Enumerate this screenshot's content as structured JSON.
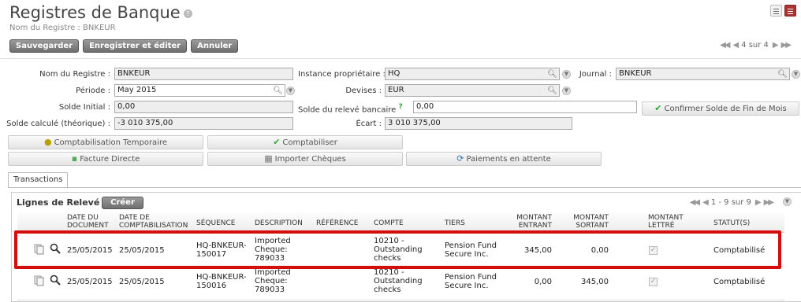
{
  "header": {
    "title": "Registres de Banque",
    "help": "?",
    "breadcrumb": "Nom du Registre : BNKEUR"
  },
  "toolbar": {
    "save_label": "Sauvegarder",
    "save_edit_label": "Enregistrer et éditer",
    "cancel_label": "Annuler",
    "pager": "4 sur 4"
  },
  "form": {
    "nom_registre_label": "Nom du Registre :",
    "nom_registre_value": "BNKEUR",
    "periode_label": "Période :",
    "periode_value": "May 2015",
    "solde_initial_label": "Solde Initial :",
    "solde_initial_value": "0,00",
    "solde_calcule_label": "Solde calculé (théorique) :",
    "solde_calcule_value": "-3 010 375,00",
    "instance_label": "Instance propriétaire :",
    "instance_value": "HQ",
    "devises_label": "Devises :",
    "devises_value": "EUR",
    "solde_releve_label": "Solde du relevé bancaire",
    "solde_releve_help": "?",
    "solde_releve_value": "0,00",
    "ecart_label": "Écart :",
    "ecart_value": "3 010 375,00",
    "journal_label": "Journal :",
    "journal_value": "BNKEUR",
    "confirm_label": "Confirmer Solde de Fin de Mois"
  },
  "actions": {
    "comptab_temp": "Comptabilisation Temporaire",
    "comptabiliser": "Comptabiliser",
    "facture_directe": "Facture Directe",
    "importer_cheques": "Importer Chèques",
    "paiements_attente": "Paiements en attente"
  },
  "tabs": {
    "transactions": "Transactions"
  },
  "lines": {
    "title": "Lignes de Relevé",
    "create_label": "Créer",
    "pager": "1 - 9 sur 9",
    "columns": {
      "date_doc": [
        "DATE DU",
        "DOCUMENT"
      ],
      "date_compta": [
        "DATE DE",
        "COMPTABILISATION"
      ],
      "sequence": "SÉQUENCE",
      "description": "DESCRIPTION",
      "reference": "RÉFÉRENCE",
      "compte": "COMPTE",
      "tiers": "TIERS",
      "montant_entrant": [
        "MONTANT",
        "ENTRANT"
      ],
      "montant_sortant": [
        "MONTANT",
        "SORTANT"
      ],
      "montant_lettre": [
        "MONTANT",
        "LETTRÉ"
      ],
      "statut": "STATUT(S)"
    },
    "rows": [
      {
        "date_doc": "25/05/2015",
        "date_compta": "25/05/2015",
        "sequence": [
          "HQ-BNKEUR-",
          "150017"
        ],
        "description": [
          "Imported",
          "Cheque:",
          "789033"
        ],
        "reference": "",
        "compte": [
          "10210 -",
          "Outstanding",
          "checks"
        ],
        "tiers": [
          "Pension Fund",
          "Secure Inc."
        ],
        "montant_entrant": "345,00",
        "montant_sortant": "0,00",
        "statut": "Comptabilisé"
      },
      {
        "date_doc": "25/05/2015",
        "date_compta": "25/05/2015",
        "sequence": [
          "HQ-BNKEUR-",
          "150016"
        ],
        "description": [
          "Imported",
          "Cheque:",
          "789033"
        ],
        "reference": "",
        "compte": [
          "10210 -",
          "Outstanding",
          "checks"
        ],
        "tiers": [
          "Pension Fund",
          "Secure Inc."
        ],
        "montant_entrant": "0,00",
        "montant_sortant": "345,00",
        "statut": "Comptabilisé"
      }
    ]
  },
  "colors": {
    "highlight": "#d40d0d",
    "button_dark": "#6f6f6f"
  }
}
